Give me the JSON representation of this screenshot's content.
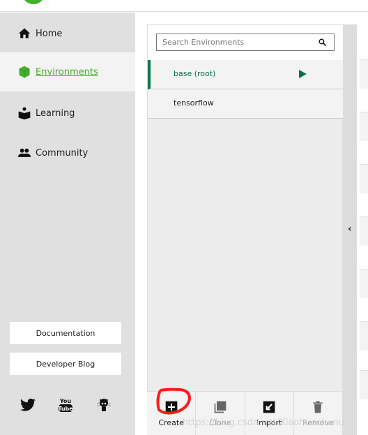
{
  "sidebar": {
    "items": [
      {
        "label": "Home",
        "icon": "home-icon"
      },
      {
        "label": "Environments",
        "icon": "cube-icon",
        "active": true
      },
      {
        "label": "Learning",
        "icon": "book-reader-icon"
      },
      {
        "label": "Community",
        "icon": "people-icon"
      }
    ],
    "buttons": {
      "documentation": "Documentation",
      "blog": "Developer Blog"
    },
    "social": [
      "twitter-icon",
      "youtube-icon",
      "github-icon"
    ]
  },
  "environments": {
    "search_placeholder": "Search Environments",
    "items": [
      {
        "name": "base (root)",
        "active": true
      },
      {
        "name": "tensorflow"
      }
    ]
  },
  "actions": [
    {
      "label": "Create",
      "icon": "plus-icon"
    },
    {
      "label": "Clone",
      "icon": "clone-icon"
    },
    {
      "label": "Import",
      "icon": "import-icon"
    },
    {
      "label": "Remove",
      "icon": "trash-icon"
    }
  ],
  "watermark": "https://blog.csdn.net/Xiaohuochunu",
  "colors": {
    "accent": "#43b02a",
    "active_env": "#0b6e4f",
    "annotation": "#ff1a1a"
  }
}
